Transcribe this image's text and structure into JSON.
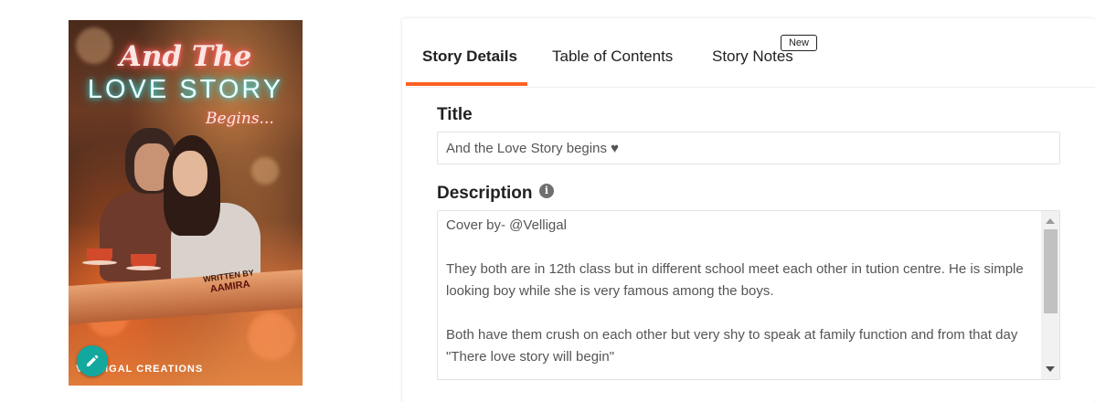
{
  "cover": {
    "title_line1": "And The",
    "title_line2": "LOVE STORY",
    "title_line3": "Begins...",
    "written_by": "WRITTEN BY",
    "author": "AAMIRA",
    "credit": "VELLIGAL CREATIONS"
  },
  "tabs": [
    {
      "label": "Story Details",
      "active": true
    },
    {
      "label": "Table of Contents",
      "active": false
    },
    {
      "label": "Story Notes",
      "active": false,
      "badge": "New"
    }
  ],
  "form": {
    "title_label": "Title",
    "title_value": "And the Love Story begins ♥",
    "description_label": "Description",
    "description_paragraphs": [
      "Cover by- @Velligal",
      "They both are in 12th class but in different school meet each other in tution centre. He is simple looking boy while she is very famous among the boys.",
      "Both have them crush on each other but very shy to speak at family function and from that day \"There love story will begin\""
    ]
  },
  "colors": {
    "accent": "#ff6122",
    "edit_button": "#12a89e"
  },
  "icons": {
    "edit": "pencil-icon",
    "info": "info-icon"
  }
}
